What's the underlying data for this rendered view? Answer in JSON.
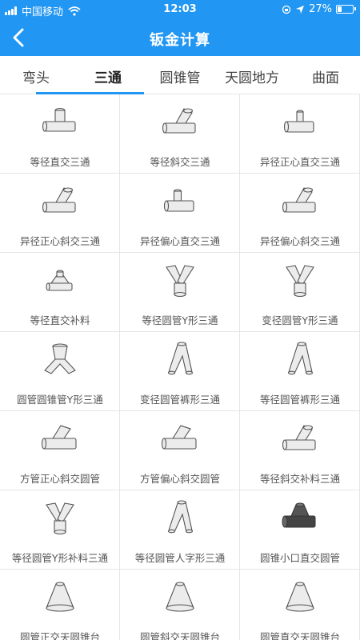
{
  "status_bar": {
    "carrier": "中国移动",
    "time": "12:03",
    "battery_percent": "27%",
    "battery_level": 0.27
  },
  "header": {
    "title": "钣金计算"
  },
  "tabs": [
    {
      "label": "弯头",
      "active": false
    },
    {
      "label": "三通",
      "active": true
    },
    {
      "label": "圆锥管",
      "active": false
    },
    {
      "label": "天圆地方",
      "active": false
    },
    {
      "label": "曲面",
      "active": false
    }
  ],
  "items": [
    {
      "label": "等径直交三通",
      "icon": "tee-straight-icon"
    },
    {
      "label": "等径斜交三通",
      "icon": "tee-oblique-icon"
    },
    {
      "label": "异径正心直交三通",
      "icon": "tee-reducing-icon"
    },
    {
      "label": "异径正心斜交三通",
      "icon": "tee-oblique-icon"
    },
    {
      "label": "异径偏心直交三通",
      "icon": "tee-offset-icon"
    },
    {
      "label": "异径偏心斜交三通",
      "icon": "tee-oblique-icon"
    },
    {
      "label": "等径直交补料",
      "icon": "tee-patch-icon"
    },
    {
      "label": "等径圆管Y形三通",
      "icon": "y-tee-icon"
    },
    {
      "label": "变径圆管Y形三通",
      "icon": "y-tee-icon"
    },
    {
      "label": "圆管圆锥管Y形三通",
      "icon": "y-cone-tee-icon"
    },
    {
      "label": "变径圆管裤形三通",
      "icon": "pants-tee-icon"
    },
    {
      "label": "等径圆管裤形三通",
      "icon": "pants-tee-icon"
    },
    {
      "label": "方管正心斜交圆管",
      "icon": "square-round-icon"
    },
    {
      "label": "方管偏心斜交圆管",
      "icon": "square-round-icon"
    },
    {
      "label": "等径斜交补料三通",
      "icon": "tee-oblique-icon"
    },
    {
      "label": "等径圆管Y形补料三通",
      "icon": "y-tee-icon"
    },
    {
      "label": "等径圆管人字形三通",
      "icon": "pants-tee-icon"
    },
    {
      "label": "圆锥小口直交圆管",
      "icon": "cone-tee-icon"
    },
    {
      "label": "圆管正交天圆锥台",
      "icon": "cone-frustum-icon"
    },
    {
      "label": "圆管斜交天圆锥台",
      "icon": "cone-frustum-icon"
    },
    {
      "label": "圆管直交天圆锥台",
      "icon": "cone-frustum-icon"
    }
  ]
}
